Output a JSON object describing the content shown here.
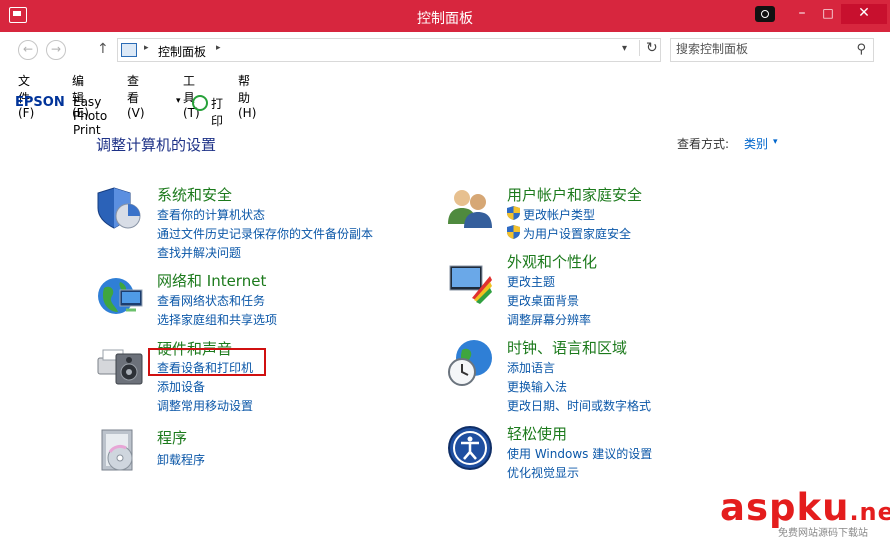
{
  "window": {
    "title": "控制面板",
    "accent": "#d7263e"
  },
  "window_controls": {
    "minimize": "–",
    "maximize": "□",
    "close": "✕"
  },
  "nav": {
    "back": "←",
    "forward": "→",
    "up": "↑"
  },
  "address": {
    "crumb": "控制面板",
    "sep1": "▸",
    "sep2": "▸",
    "dropdown": "▾",
    "refresh": "↻"
  },
  "search": {
    "placeholder": "搜索控制面板",
    "icon": "⚲"
  },
  "menu": [
    "文件(F)",
    "编辑(E)",
    "查看(V)",
    "工具(T)",
    "帮助(H)"
  ],
  "epson": {
    "logo": "EPSON",
    "app": "Easy Photo Print",
    "dropdown": "▾",
    "print": "打印"
  },
  "main": {
    "heading": "调整计算机的设置",
    "view_by_label": "查看方式:",
    "view_by_value": "类别",
    "view_arrow": "▾"
  },
  "categories": {
    "system": {
      "title": "系统和安全",
      "links": [
        "查看你的计算机状态",
        "通过文件历史记录保存你的文件备份副本",
        "查找并解决问题"
      ]
    },
    "network": {
      "title": "网络和 Internet",
      "links": [
        "查看网络状态和任务",
        "选择家庭组和共享选项"
      ]
    },
    "hardware": {
      "title": "硬件和声音",
      "links": [
        "查看设备和打印机",
        "添加设备",
        "调整常用移动设置"
      ]
    },
    "programs": {
      "title": "程序",
      "links": [
        "卸载程序"
      ]
    },
    "users": {
      "title": "用户帐户和家庭安全",
      "links": [
        "更改帐户类型",
        "为用户设置家庭安全"
      ]
    },
    "appearance": {
      "title": "外观和个性化",
      "links": [
        "更改主题",
        "更改桌面背景",
        "调整屏幕分辨率"
      ]
    },
    "clock": {
      "title": "时钟、语言和区域",
      "links": [
        "添加语言",
        "更换输入法",
        "更改日期、时间或数字格式"
      ]
    },
    "ease": {
      "title": "轻松使用",
      "links": [
        "使用 Windows 建议的设置",
        "优化视觉显示"
      ]
    }
  },
  "watermark": {
    "main": "asp",
    "ku": "ku",
    "dotnet": ".net",
    "sub": "免费网站源码下载站"
  }
}
